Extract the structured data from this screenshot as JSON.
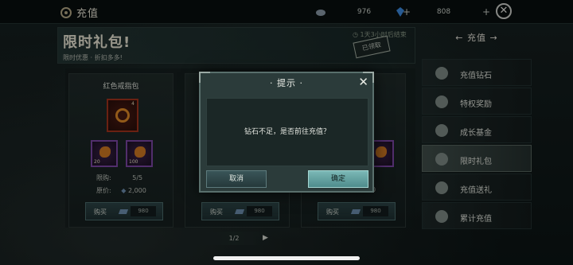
{
  "header": {
    "title": "充值",
    "currency_a": "976",
    "currency_b": "808",
    "plus": "+",
    "close": "✕"
  },
  "panel": {
    "title": "限时礼包!",
    "subtitle": "限时优惠 · 折扣多多!",
    "countdown": "◷ 1天3小时后结束",
    "claimed": "已领取"
  },
  "cards": [
    {
      "name": "红色戒指包",
      "main_count": "4",
      "sub_counts": [
        "20",
        "100"
      ],
      "limit_label": "限购:",
      "limit_value": "5/5",
      "original_label": "原价:",
      "original_value": "2,000",
      "buy_label": "购买",
      "price": "980"
    },
    {
      "buy_label": "购买",
      "price": "980"
    },
    {
      "right_partial": "0",
      "buy_label": "购买",
      "price": "980"
    }
  ],
  "pager": {
    "text": "1/2",
    "next": "▶"
  },
  "sidebar": {
    "head": "← 充值 →",
    "items": [
      {
        "label": "充值钻石"
      },
      {
        "label": "特权奖励"
      },
      {
        "label": "成长基金"
      },
      {
        "label": "限时礼包"
      },
      {
        "label": "充值送礼"
      },
      {
        "label": "累计充值"
      }
    ]
  },
  "dialog": {
    "title": "· 提示 ·",
    "close": "✕",
    "message": "钻石不足，是否前往充值？",
    "cancel": "取消",
    "confirm": "确定"
  },
  "colors": {
    "accent": "#7bb8b6",
    "panel_bg": "#2b3b3a",
    "item_border_red": "#a4341d",
    "item_border_purple": "#7d47a6"
  }
}
